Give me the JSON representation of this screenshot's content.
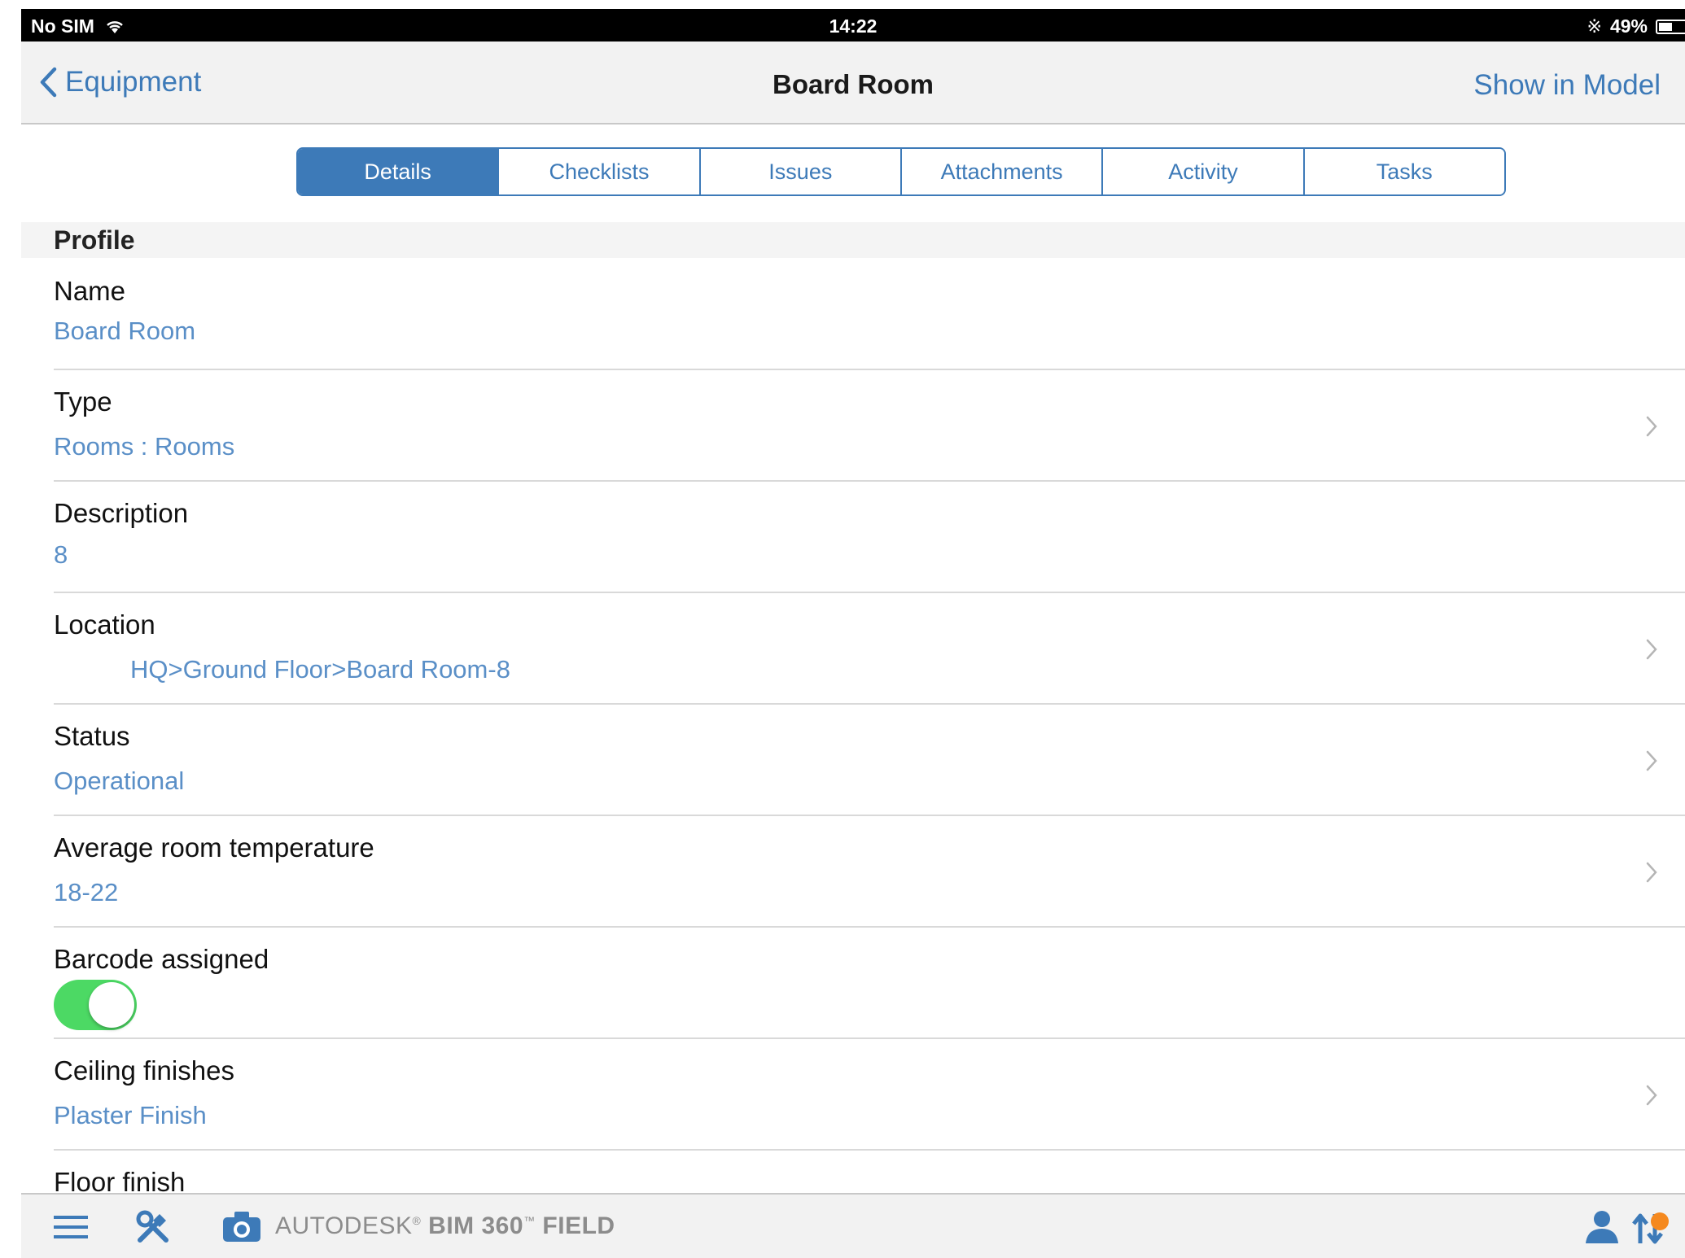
{
  "status_bar": {
    "carrier": "No SIM",
    "time": "14:22",
    "battery": "49%",
    "battery_level": 0.49
  },
  "nav": {
    "back_label": "Equipment",
    "title": "Board Room",
    "action_label": "Show in Model"
  },
  "tabs": [
    {
      "label": "Details",
      "active": true
    },
    {
      "label": "Checklists",
      "active": false
    },
    {
      "label": "Issues",
      "active": false
    },
    {
      "label": "Attachments",
      "active": false
    },
    {
      "label": "Activity",
      "active": false
    },
    {
      "label": "Tasks",
      "active": false
    }
  ],
  "section": {
    "title": "Profile"
  },
  "fields": {
    "name": {
      "label": "Name",
      "value": "Board Room"
    },
    "type": {
      "label": "Type",
      "value": "Rooms : Rooms"
    },
    "description": {
      "label": "Description",
      "value": "8"
    },
    "location": {
      "label": "Location",
      "value": "HQ>Ground Floor>Board Room-8"
    },
    "status": {
      "label": "Status",
      "value": "Operational"
    },
    "temperature": {
      "label": "Average room temperature",
      "value": "18-22"
    },
    "barcode": {
      "label": "Barcode assigned",
      "enabled": true
    },
    "ceiling": {
      "label": "Ceiling finishes",
      "value": "Plaster Finish"
    },
    "floor": {
      "label": "Floor finish"
    }
  },
  "bottom_bar": {
    "brand_prefix": "AUTODESK",
    "brand_name": "BIM 360",
    "brand_suffix": "FIELD"
  },
  "colors": {
    "accent": "#3d7ab8",
    "value_text": "#5a8fc7",
    "toggle_on": "#4cd964",
    "badge": "#f5891f"
  }
}
